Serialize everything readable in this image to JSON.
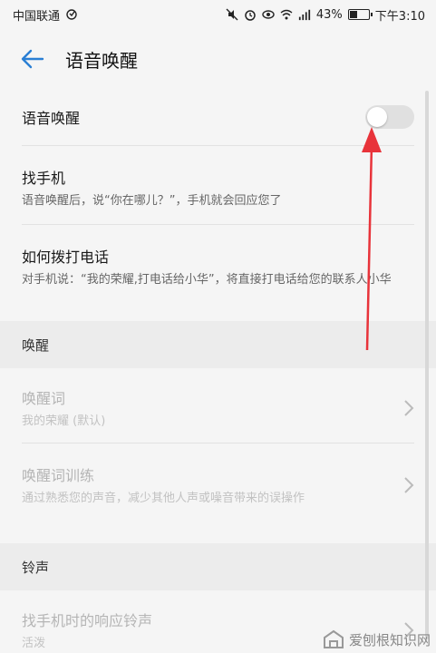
{
  "statusbar": {
    "carrier": "中国联通",
    "battery_percent": "43%",
    "battery_level": 0.43,
    "time": "下午3:10"
  },
  "header": {
    "title": "语音唤醒"
  },
  "settings": {
    "voice_wakeup": {
      "label": "语音唤醒",
      "enabled": false
    },
    "find_phone": {
      "label": "找手机",
      "desc": "语音唤醒后，说“你在哪儿？”，手机就会回应您了"
    },
    "make_call": {
      "label": "如何拨打电话",
      "desc": "对手机说：“我的荣耀,打电话给小华”，将直接打电话给您的联系人小华"
    }
  },
  "wakeup_section": {
    "header": "唤醒",
    "wake_word": {
      "label": "唤醒词",
      "value": "我的荣耀 (默认)"
    },
    "wake_training": {
      "label": "唤醒词训练",
      "desc": "通过熟悉您的声音，减少其他人声或噪音带来的误操作"
    }
  },
  "ringtone_section": {
    "header": "铃声",
    "find_ringtone": {
      "label": "找手机时的响应铃声",
      "value": "活泼"
    }
  },
  "watermark": {
    "text": "爱刨根知识网"
  },
  "colors": {
    "accent": "#2a7fd4",
    "arrow": "#e8333a"
  }
}
